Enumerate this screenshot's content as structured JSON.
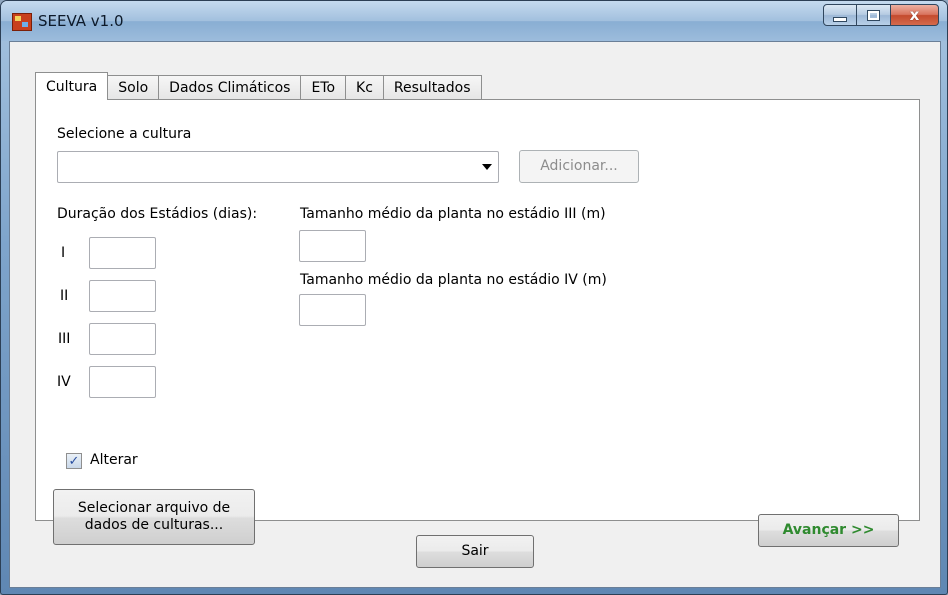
{
  "window": {
    "title": "SEEVA v1.0",
    "controls": {
      "minimize": "minimize",
      "maximize": "maximize",
      "close": "x"
    }
  },
  "tabs": [
    {
      "label": "Cultura",
      "active": true
    },
    {
      "label": "Solo"
    },
    {
      "label": "Dados Climáticos"
    },
    {
      "label": "ETo"
    },
    {
      "label": "Kc"
    },
    {
      "label": "Resultados"
    }
  ],
  "cultura": {
    "select_label": "Selecione a cultura",
    "select_value": "",
    "add_button": "Adicionar...",
    "duration_label": "Duração dos Estádios (dias):",
    "stages": [
      {
        "label": "I",
        "value": ""
      },
      {
        "label": "II",
        "value": ""
      },
      {
        "label": "III",
        "value": ""
      },
      {
        "label": "IV",
        "value": ""
      }
    ],
    "size_iii_label": "Tamanho médio da planta no estádio III (m)",
    "size_iii_value": "",
    "size_iv_label": "Tamanho médio da planta no estádio IV (m)",
    "size_iv_value": "",
    "alterar_label": "Alterar",
    "alterar_checked": true,
    "select_file_button_line1": "Selecionar arquivo de",
    "select_file_button_line2": "dados de culturas...",
    "next_button": "Avançar >>",
    "next_color": "#2f8a2f"
  },
  "footer": {
    "exit_button": "Sair"
  }
}
